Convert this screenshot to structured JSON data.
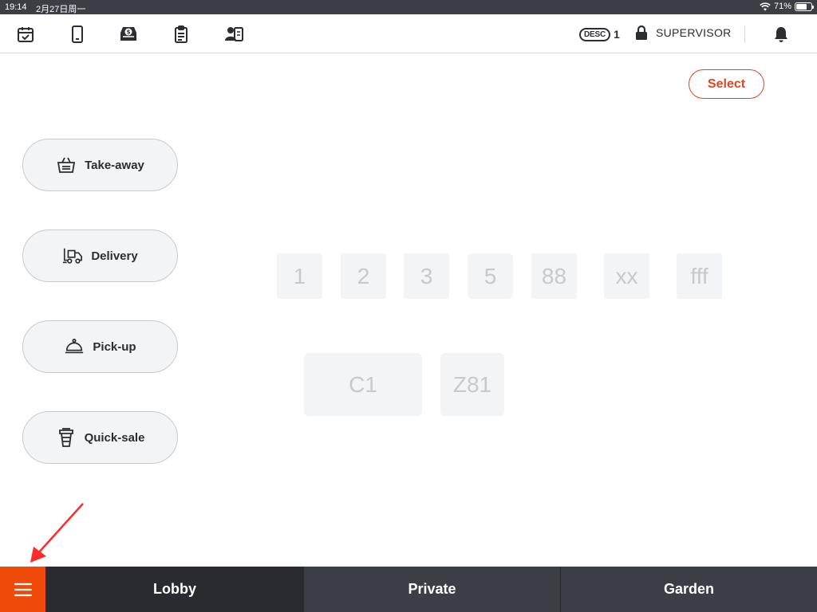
{
  "status_bar": {
    "time": "19:14",
    "date": "2月27日周一",
    "battery": "71%",
    "battery_level": 0.71
  },
  "toolbar": {
    "icons": [
      "calendar-check-icon",
      "tablet-icon",
      "cash-drawer-icon",
      "clipboard-icon",
      "staff-card-icon"
    ],
    "desc_label": "DESC",
    "desc_count": "1",
    "user_role": "SUPERVISOR"
  },
  "select_label": "Select",
  "order_types": [
    {
      "label": "Take-away",
      "icon": "basket-icon"
    },
    {
      "label": "Delivery",
      "icon": "forklift-icon"
    },
    {
      "label": "Pick-up",
      "icon": "cloche-icon"
    },
    {
      "label": "Quick-sale",
      "icon": "cup-icon"
    }
  ],
  "tables": [
    "1",
    "2",
    "3",
    "5",
    "88",
    "xx",
    "fff",
    "C1",
    "Z81"
  ],
  "bottom_tabs": [
    {
      "label": "Lobby",
      "active": true
    },
    {
      "label": "Private",
      "active": false
    },
    {
      "label": "Garden",
      "active": false
    }
  ],
  "colors": {
    "accent": "#e0461e",
    "menu": "#f04a0a",
    "bottom_bar": "#3c3e46",
    "active_tab": "#2a2b30"
  }
}
